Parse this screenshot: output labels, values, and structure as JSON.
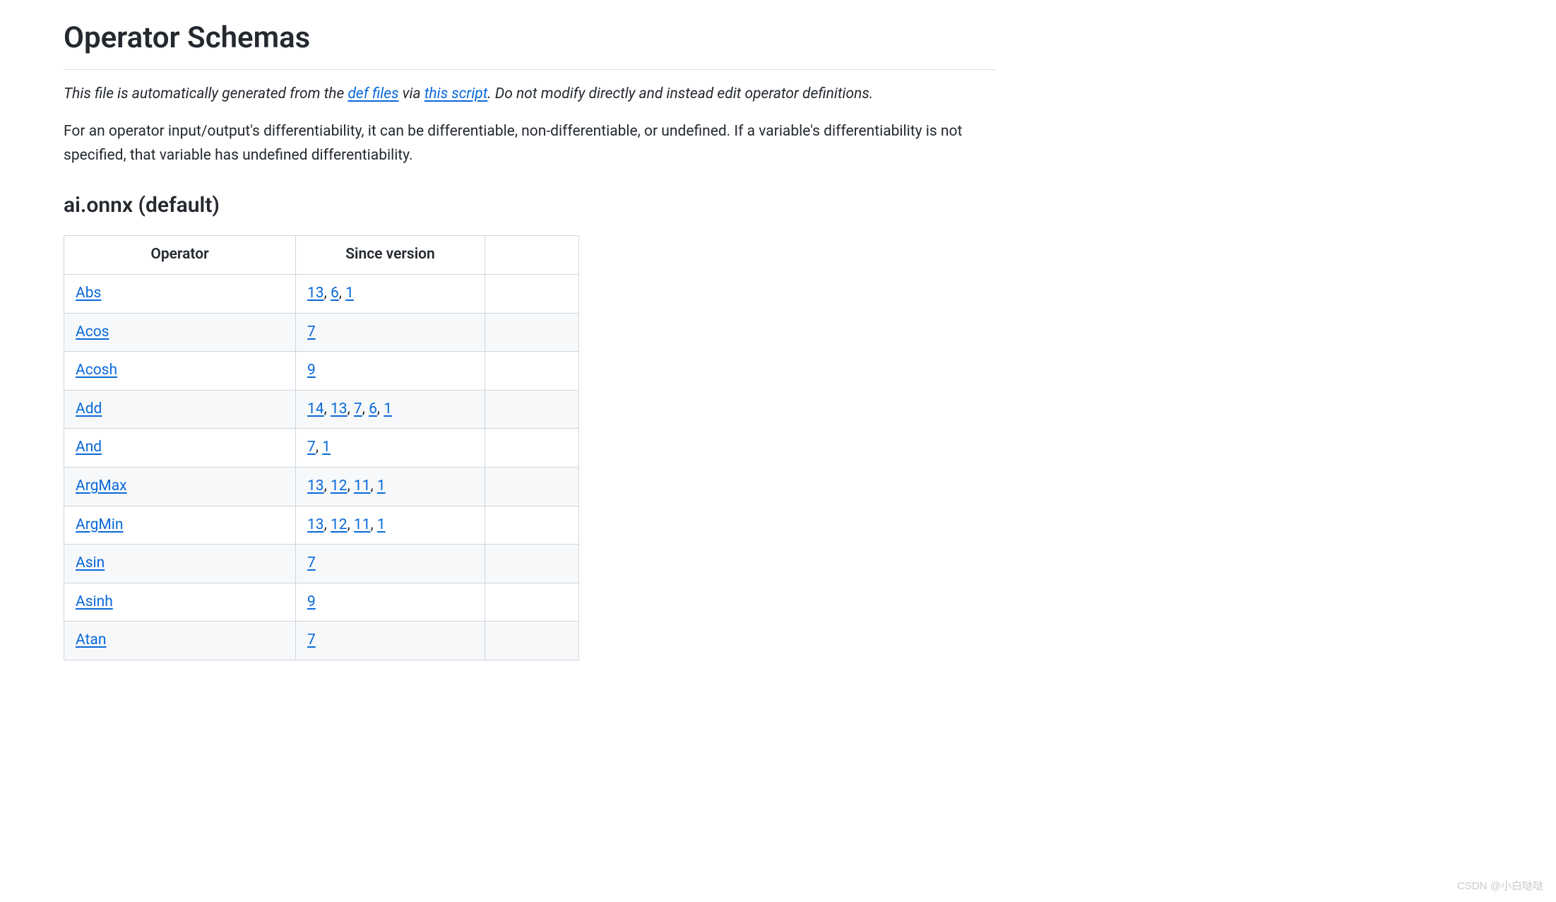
{
  "title": "Operator Schemas",
  "intro": {
    "prefix": "This file is automatically generated from the ",
    "link1": "def files",
    "middle": " via ",
    "link2": "this script",
    "suffix": ". Do not modify directly and instead edit operator definitions."
  },
  "desc": "For an operator input/output's differentiability, it can be differentiable, non-differentiable, or undefined. If a variable's differentiability is not specified, that variable has undefined differentiability.",
  "section": "ai.onnx (default)",
  "headers": {
    "col1": "Operator",
    "col2": "Since version"
  },
  "rows": [
    {
      "op": "Abs",
      "versions": [
        "13",
        "6",
        "1"
      ]
    },
    {
      "op": "Acos",
      "versions": [
        "7"
      ]
    },
    {
      "op": "Acosh",
      "versions": [
        "9"
      ]
    },
    {
      "op": "Add",
      "versions": [
        "14",
        "13",
        "7",
        "6",
        "1"
      ]
    },
    {
      "op": "And",
      "versions": [
        "7",
        "1"
      ]
    },
    {
      "op": "ArgMax",
      "versions": [
        "13",
        "12",
        "11",
        "1"
      ]
    },
    {
      "op": "ArgMin",
      "versions": [
        "13",
        "12",
        "11",
        "1"
      ]
    },
    {
      "op": "Asin",
      "versions": [
        "7"
      ]
    },
    {
      "op": "Asinh",
      "versions": [
        "9"
      ]
    },
    {
      "op": "Atan",
      "versions": [
        "7"
      ]
    }
  ],
  "watermark": "CSDN @小白哒哒"
}
